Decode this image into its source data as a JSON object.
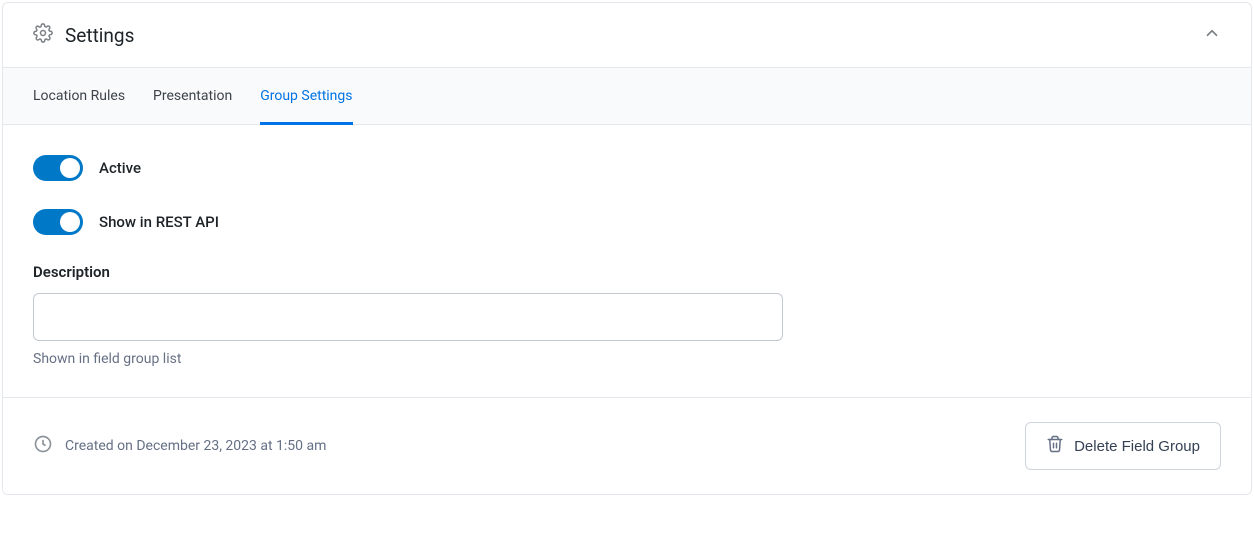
{
  "header": {
    "title": "Settings"
  },
  "tabs": [
    {
      "label": "Location Rules",
      "active": false
    },
    {
      "label": "Presentation",
      "active": false
    },
    {
      "label": "Group Settings",
      "active": true
    }
  ],
  "toggles": {
    "active": {
      "label": "Active",
      "on": true
    },
    "rest": {
      "label": "Show in REST API",
      "on": true
    }
  },
  "description": {
    "label": "Description",
    "value": "",
    "help": "Shown in field group list"
  },
  "footer": {
    "created_text": "Created on December 23, 2023 at 1:50 am",
    "delete_label": "Delete Field Group"
  }
}
